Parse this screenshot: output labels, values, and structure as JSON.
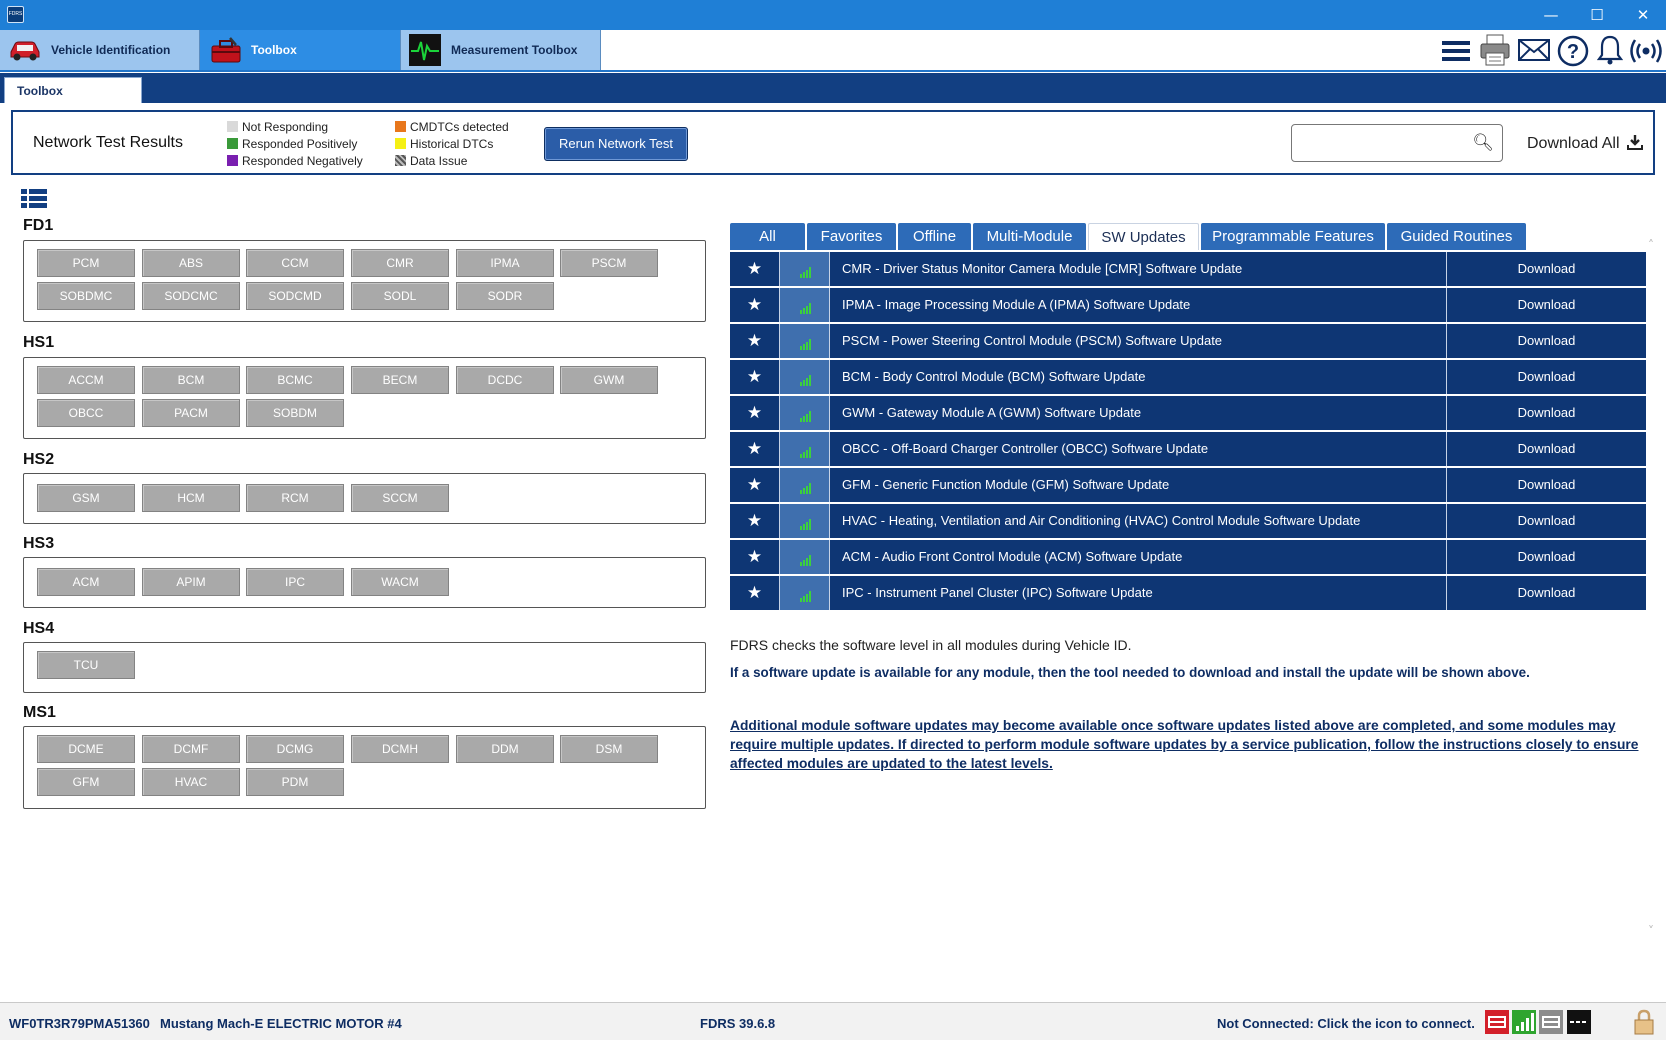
{
  "window": {
    "logo_text": "FDRS",
    "minimize": "—",
    "maximize": "☐",
    "close": "✕"
  },
  "top_tabs": [
    {
      "label": "Vehicle Identification",
      "icon": "car-icon"
    },
    {
      "label": "Toolbox",
      "icon": "toolbox-icon"
    },
    {
      "label": "Measurement Toolbox",
      "icon": "oscilloscope-icon"
    }
  ],
  "toolbar_icons": [
    "menu-icon",
    "printer-icon",
    "mail-icon",
    "help-icon",
    "bell-icon",
    "wireless-icon"
  ],
  "sub_tab": {
    "label": "Toolbox"
  },
  "network_test": {
    "title": "Network Test Results",
    "legend": [
      {
        "label": "Not Responding",
        "color": "#d9d9d9"
      },
      {
        "label": "Responded Positively",
        "color": "#3a9a3a"
      },
      {
        "label": "Responded Negatively",
        "color": "#7a1fb0"
      },
      {
        "label": "CMDTCs detected",
        "color": "#e8771c"
      },
      {
        "label": "Historical DTCs",
        "color": "#f5f014"
      },
      {
        "label": "Data Issue",
        "color": "#888888"
      }
    ],
    "rerun_label": "Rerun Network Test",
    "search_value": "",
    "download_all_label": "Download All"
  },
  "module_groups": [
    {
      "name": "FD1",
      "modules": [
        "PCM",
        "ABS",
        "CCM",
        "CMR",
        "IPMA",
        "PSCM",
        "SOBDMC",
        "SODCMC",
        "SODCMD",
        "SODL",
        "SODR"
      ]
    },
    {
      "name": "HS1",
      "modules": [
        "ACCM",
        "BCM",
        "BCMC",
        "BECM",
        "DCDC",
        "GWM",
        "OBCC",
        "PACM",
        "SOBDM"
      ]
    },
    {
      "name": "HS2",
      "modules": [
        "GSM",
        "HCM",
        "RCM",
        "SCCM"
      ]
    },
    {
      "name": "HS3",
      "modules": [
        "ACM",
        "APIM",
        "IPC",
        "WACM"
      ]
    },
    {
      "name": "HS4",
      "modules": [
        "TCU"
      ]
    },
    {
      "name": "MS1",
      "modules": [
        "DCME",
        "DCMF",
        "DCMG",
        "DCMH",
        "DDM",
        "DSM",
        "GFM",
        "HVAC",
        "PDM"
      ]
    }
  ],
  "right_tabs": [
    {
      "label": "All"
    },
    {
      "label": "Favorites"
    },
    {
      "label": "Offline"
    },
    {
      "label": "Multi-Module"
    },
    {
      "label": "SW Updates",
      "active": true
    },
    {
      "label": "Programmable Features"
    },
    {
      "label": "Guided Routines"
    }
  ],
  "updates": [
    {
      "description": "CMR - Driver Status Monitor Camera Module [CMR] Software Update",
      "action": "Download"
    },
    {
      "description": "IPMA - Image Processing Module A (IPMA) Software Update",
      "action": "Download"
    },
    {
      "description": "PSCM - Power Steering Control Module (PSCM) Software Update",
      "action": "Download"
    },
    {
      "description": "BCM - Body Control Module (BCM) Software Update",
      "action": "Download"
    },
    {
      "description": "GWM - Gateway Module A (GWM) Software Update",
      "action": "Download"
    },
    {
      "description": "OBCC - Off-Board Charger Controller (OBCC) Software Update",
      "action": "Download"
    },
    {
      "description": "GFM - Generic Function Module (GFM) Software Update",
      "action": "Download"
    },
    {
      "description": "HVAC - Heating, Ventilation and Air Conditioning (HVAC) Control Module Software Update",
      "action": "Download"
    },
    {
      "description": "ACM - Audio Front Control Module (ACM) Software Update",
      "action": "Download"
    },
    {
      "description": "IPC - Instrument Panel Cluster (IPC) Software Update",
      "action": "Download"
    }
  ],
  "info": {
    "line1": "FDRS checks the software level in all modules during Vehicle ID.",
    "line2": "If a software update is available for any module, then the tool needed to download and install the update will be shown above.",
    "line3": "Additional module software updates may become available once software updates listed above are completed, and some modules may require multiple updates. If directed to perform module software updates by a service publication, follow the instructions closely to ensure affected modules are updated to the latest levels."
  },
  "status": {
    "vin": "WF0TR3R79PMA51360",
    "vehicle": "Mustang Mach-E ELECTRIC MOTOR #4",
    "version": "FDRS 39.6.8",
    "connection": "Not Connected: Click the icon to connect."
  },
  "colors": {
    "titlebar": "#1f7fd6",
    "band": "#123f82",
    "row_bg": "#0e3674",
    "module_gray": "#a9a9a9",
    "tab_blue": "#2d6bb8",
    "link_text": "#0e2d63"
  }
}
